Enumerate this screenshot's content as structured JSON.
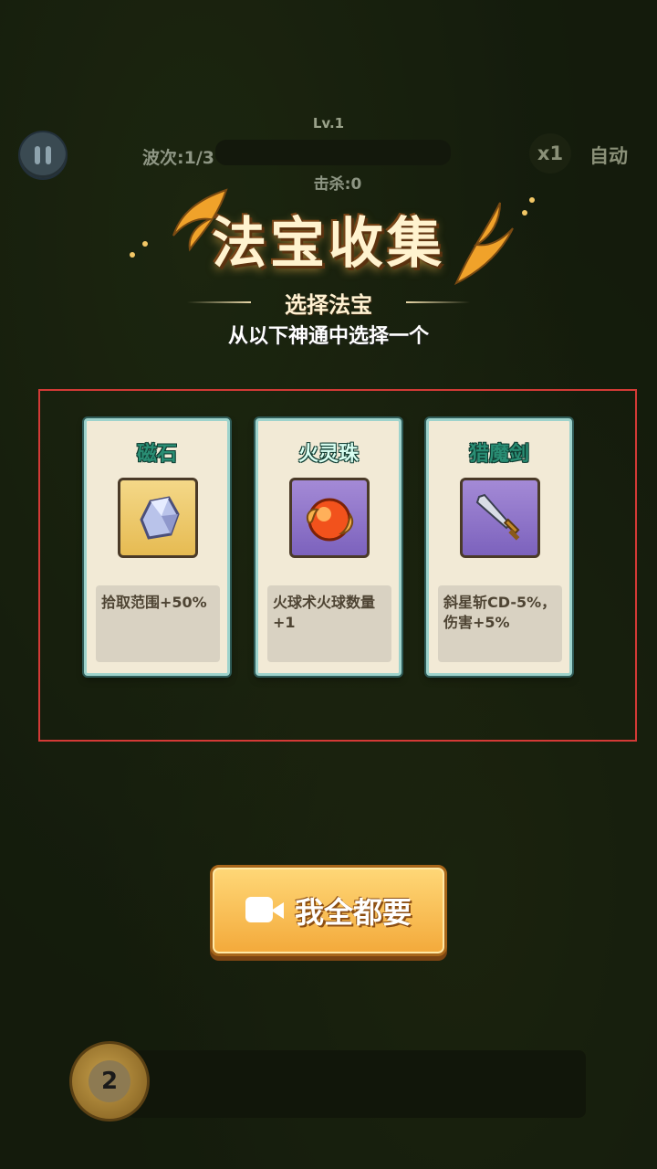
{
  "hud": {
    "level": "Lv.1",
    "wave": "波次:1/3",
    "kills": "击杀:0",
    "speed": "x1",
    "auto": "自动",
    "wave_progress": 0
  },
  "dialog": {
    "title": "法宝收集",
    "subtitle": "选择法宝",
    "instruction": "从以下神通中选择一个"
  },
  "cards": [
    {
      "name": "磁石",
      "description": "拾取范围+50%",
      "icon": "magnet-stone-icon"
    },
    {
      "name": "火灵珠",
      "description": "火球术火球数量+1",
      "icon": "fire-orb-icon"
    },
    {
      "name": "猎魔剑",
      "description": "斜星斩CD-5%，伤害+5%",
      "icon": "sword-icon"
    }
  ],
  "all_button": {
    "label": "我全都要",
    "icon": "video-camera-icon"
  },
  "footer": {
    "count": "2"
  },
  "colors": {
    "accent": "#f3a93a",
    "card_name": "#2a8e74",
    "frame": "#d33a36"
  }
}
